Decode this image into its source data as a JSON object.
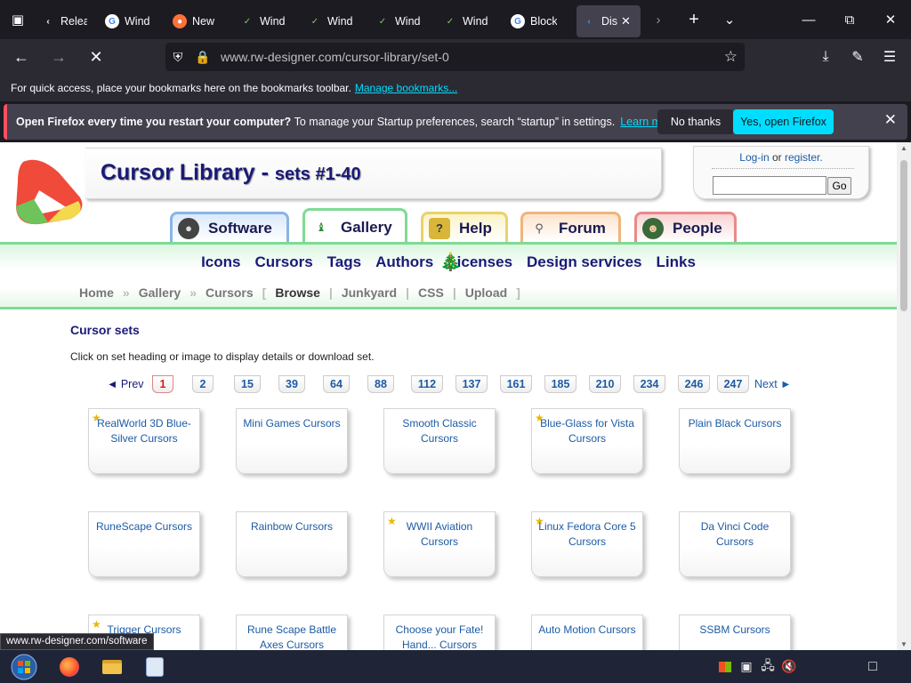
{
  "browser": {
    "tabs": [
      {
        "label": "Relea",
        "icon": "chevron-left-icon"
      },
      {
        "label": "Wind",
        "icon": "google-icon"
      },
      {
        "label": "New",
        "icon": "firefox-icon"
      },
      {
        "label": "Wind",
        "icon": "terminal-icon"
      },
      {
        "label": "Wind",
        "icon": "terminal-icon"
      },
      {
        "label": "Wind",
        "icon": "terminal-icon"
      },
      {
        "label": "Wind",
        "icon": "terminal-icon"
      },
      {
        "label": "Block",
        "icon": "google-icon"
      },
      {
        "label": "Dis",
        "icon": "page-icon"
      }
    ],
    "url_host": "www.rw-designer.com",
    "url_path": "/cursor-library/set-0",
    "bookmarks_text": "For quick access, place your bookmarks here on the bookmarks toolbar.",
    "bookmarks_link": "Manage bookmarks...",
    "notification": {
      "bold": "Open Firefox every time you restart your computer?",
      "text": "To manage your Startup preferences, search “startup” in settings.",
      "learn_more": "Learn more",
      "no_thanks": "No thanks",
      "yes_open": "Yes, open Firefox"
    },
    "status_url": "www.rw-designer.com/software"
  },
  "site": {
    "title": "Cursor Library - ",
    "title_sets": "sets #1-40",
    "login": "Log-in",
    "or": "or",
    "register": "register.",
    "go": "Go",
    "main_tabs": [
      "Software",
      "Gallery",
      "Help",
      "Forum",
      "People"
    ],
    "subnav": [
      "Icons",
      "Cursors",
      "Tags",
      "Authors",
      "Licenses",
      "Design services",
      "Links"
    ],
    "crumbs": [
      "Home",
      "Gallery",
      "Cursors",
      "Browse",
      "Junkyard",
      "CSS",
      "Upload"
    ],
    "sets_title": "Cursor sets",
    "sets_desc": "Click on set heading or image to display details or download set.",
    "pager": {
      "prev": "◄ Prev",
      "next": "Next ►",
      "pages": [
        "1",
        "2",
        "15",
        "39",
        "64",
        "88",
        "112",
        "137",
        "161",
        "185",
        "210",
        "234",
        "246",
        "247"
      ]
    },
    "cards": [
      {
        "title": "RealWorld 3D Blue-Silver Cursors",
        "star": true
      },
      {
        "title": "Mini Games Cursors",
        "star": false
      },
      {
        "title": "Smooth Classic Cursors",
        "star": false
      },
      {
        "title": "Blue-Glass for Vista Cursors",
        "star": true
      },
      {
        "title": "Plain Black Cursors",
        "star": false
      },
      {
        "title": "RuneScape Cursors",
        "star": false
      },
      {
        "title": "Rainbow Cursors",
        "star": false
      },
      {
        "title": "WWII Aviation Cursors",
        "star": true
      },
      {
        "title": "Linux Fedora Core 5 Cursors",
        "star": true
      },
      {
        "title": "Da Vinci Code Cursors",
        "star": false
      },
      {
        "title": "Trigger Cursors",
        "star": true
      },
      {
        "title": "Rune Scape Battle Axes Cursors",
        "star": false
      },
      {
        "title": "Choose your Fate! Hand... Cursors",
        "star": false
      },
      {
        "title": "Auto Motion Cursors",
        "star": false
      },
      {
        "title": "SSBM Cursors",
        "star": false
      }
    ]
  },
  "colors": {
    "accent": "#00ddff",
    "site_title": "#1a1a78",
    "link": "#1c5ba5",
    "green_border": "#7edb94"
  }
}
